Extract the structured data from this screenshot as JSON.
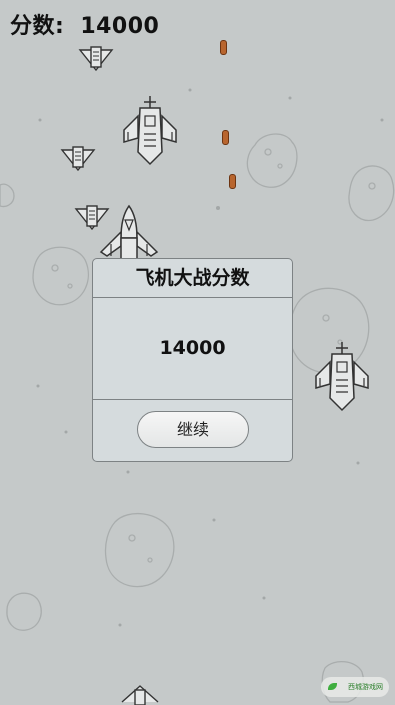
{
  "hud": {
    "score_label": "分数:",
    "score_value": "14000"
  },
  "dialog": {
    "title": "飞机大战分数",
    "score": "14000",
    "continue_label": "继续"
  },
  "watermark": {
    "text": "西城游戏网"
  },
  "colors": {
    "background": "#c5c9c9",
    "bullet": "#b8652e",
    "dialog_bg": "#d5dbdd",
    "dialog_border": "#7d8284"
  },
  "icons": {
    "enemy_small": "enemy-small-plane-icon",
    "enemy_medium": "enemy-medium-plane-icon",
    "player": "player-plane-icon",
    "bullet": "bullet-icon",
    "asteroid": "asteroid-icon"
  }
}
